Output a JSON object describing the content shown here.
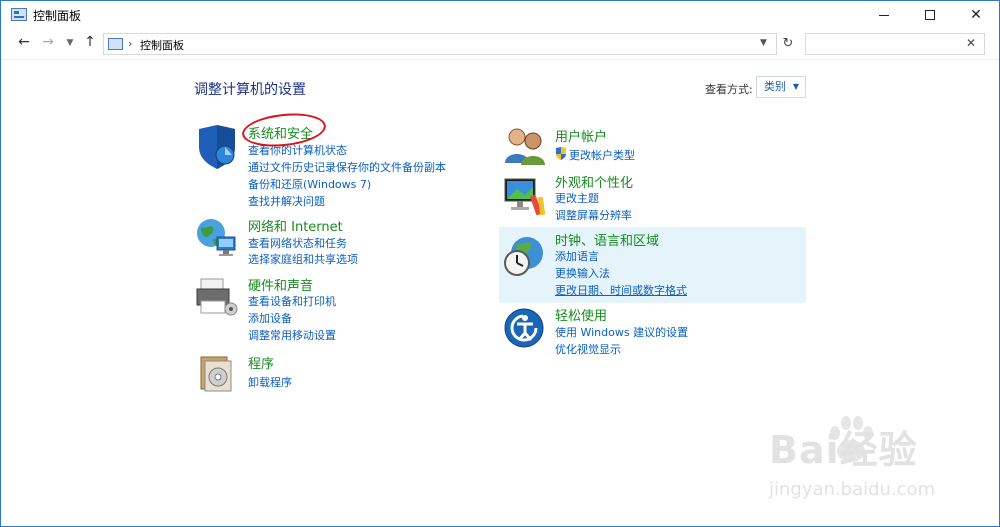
{
  "window": {
    "title": "控制面板"
  },
  "nav": {
    "address_text": "控制面板",
    "search_placeholder": ""
  },
  "content": {
    "heading": "调整计算机的设置",
    "view_by_label": "查看方式:",
    "view_by_value": "类别"
  },
  "categories_left": [
    {
      "title": "系统和安全",
      "links": [
        "查看你的计算机状态",
        "通过文件历史记录保存你的文件备份副本",
        "备份和还原(Windows 7)",
        "查找并解决问题"
      ]
    },
    {
      "title": "网络和 Internet",
      "links": [
        "查看网络状态和任务",
        "选择家庭组和共享选项"
      ]
    },
    {
      "title": "硬件和声音",
      "links": [
        "查看设备和打印机",
        "添加设备",
        "调整常用移动设置"
      ]
    },
    {
      "title": "程序",
      "links": [
        "卸载程序"
      ]
    }
  ],
  "categories_right": [
    {
      "title": "用户帐户",
      "links": [
        "更改帐户类型"
      ]
    },
    {
      "title": "外观和个性化",
      "links": [
        "更改主题",
        "调整屏幕分辨率"
      ]
    },
    {
      "title": "时钟、语言和区域",
      "links": [
        "添加语言",
        "更换输入法",
        "更改日期、时间或数字格式"
      ]
    },
    {
      "title": "轻松使用",
      "links": [
        "使用 Windows 建议的设置",
        "优化视觉显示"
      ]
    }
  ],
  "watermark": {
    "brand": "Bai经验",
    "url": "jingyan.baidu.com"
  }
}
